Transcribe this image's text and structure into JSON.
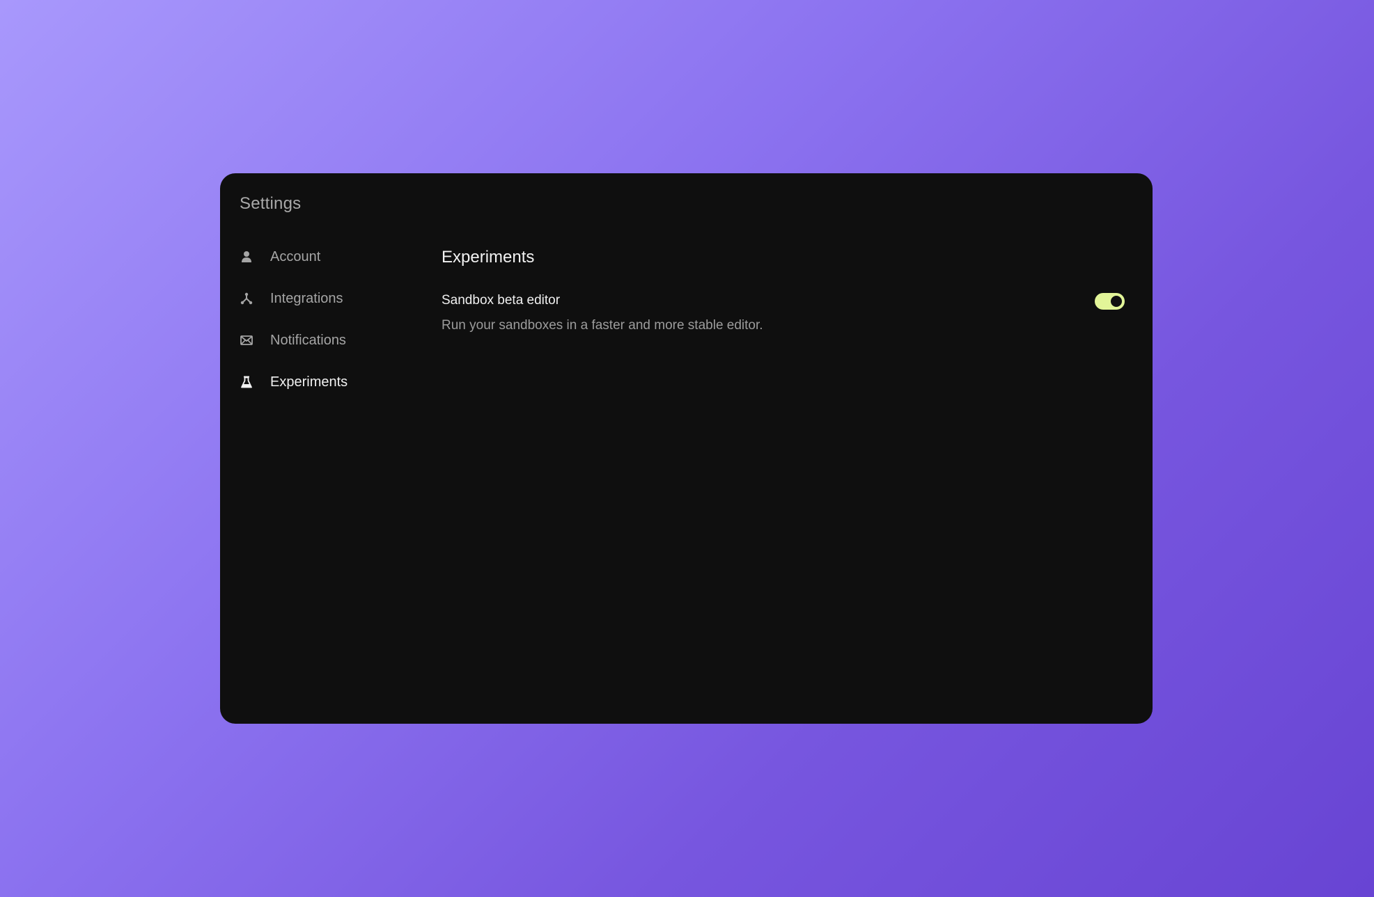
{
  "window": {
    "title": "Settings"
  },
  "sidebar": {
    "items": [
      {
        "label": "Account",
        "icon": "user-icon",
        "active": false
      },
      {
        "label": "Integrations",
        "icon": "integrations-icon",
        "active": false
      },
      {
        "label": "Notifications",
        "icon": "envelope-icon",
        "active": false
      },
      {
        "label": "Experiments",
        "icon": "flask-icon",
        "active": true
      }
    ]
  },
  "main": {
    "section_title": "Experiments",
    "settings": [
      {
        "label": "Sandbox beta editor",
        "description": "Run your sandboxes in a faster and more stable editor.",
        "enabled": true
      }
    ]
  },
  "colors": {
    "toggle_on": "#e2f598",
    "panel_bg": "#0f0f0f",
    "background_start": "#a898fc",
    "background_end": "#6844d3"
  }
}
